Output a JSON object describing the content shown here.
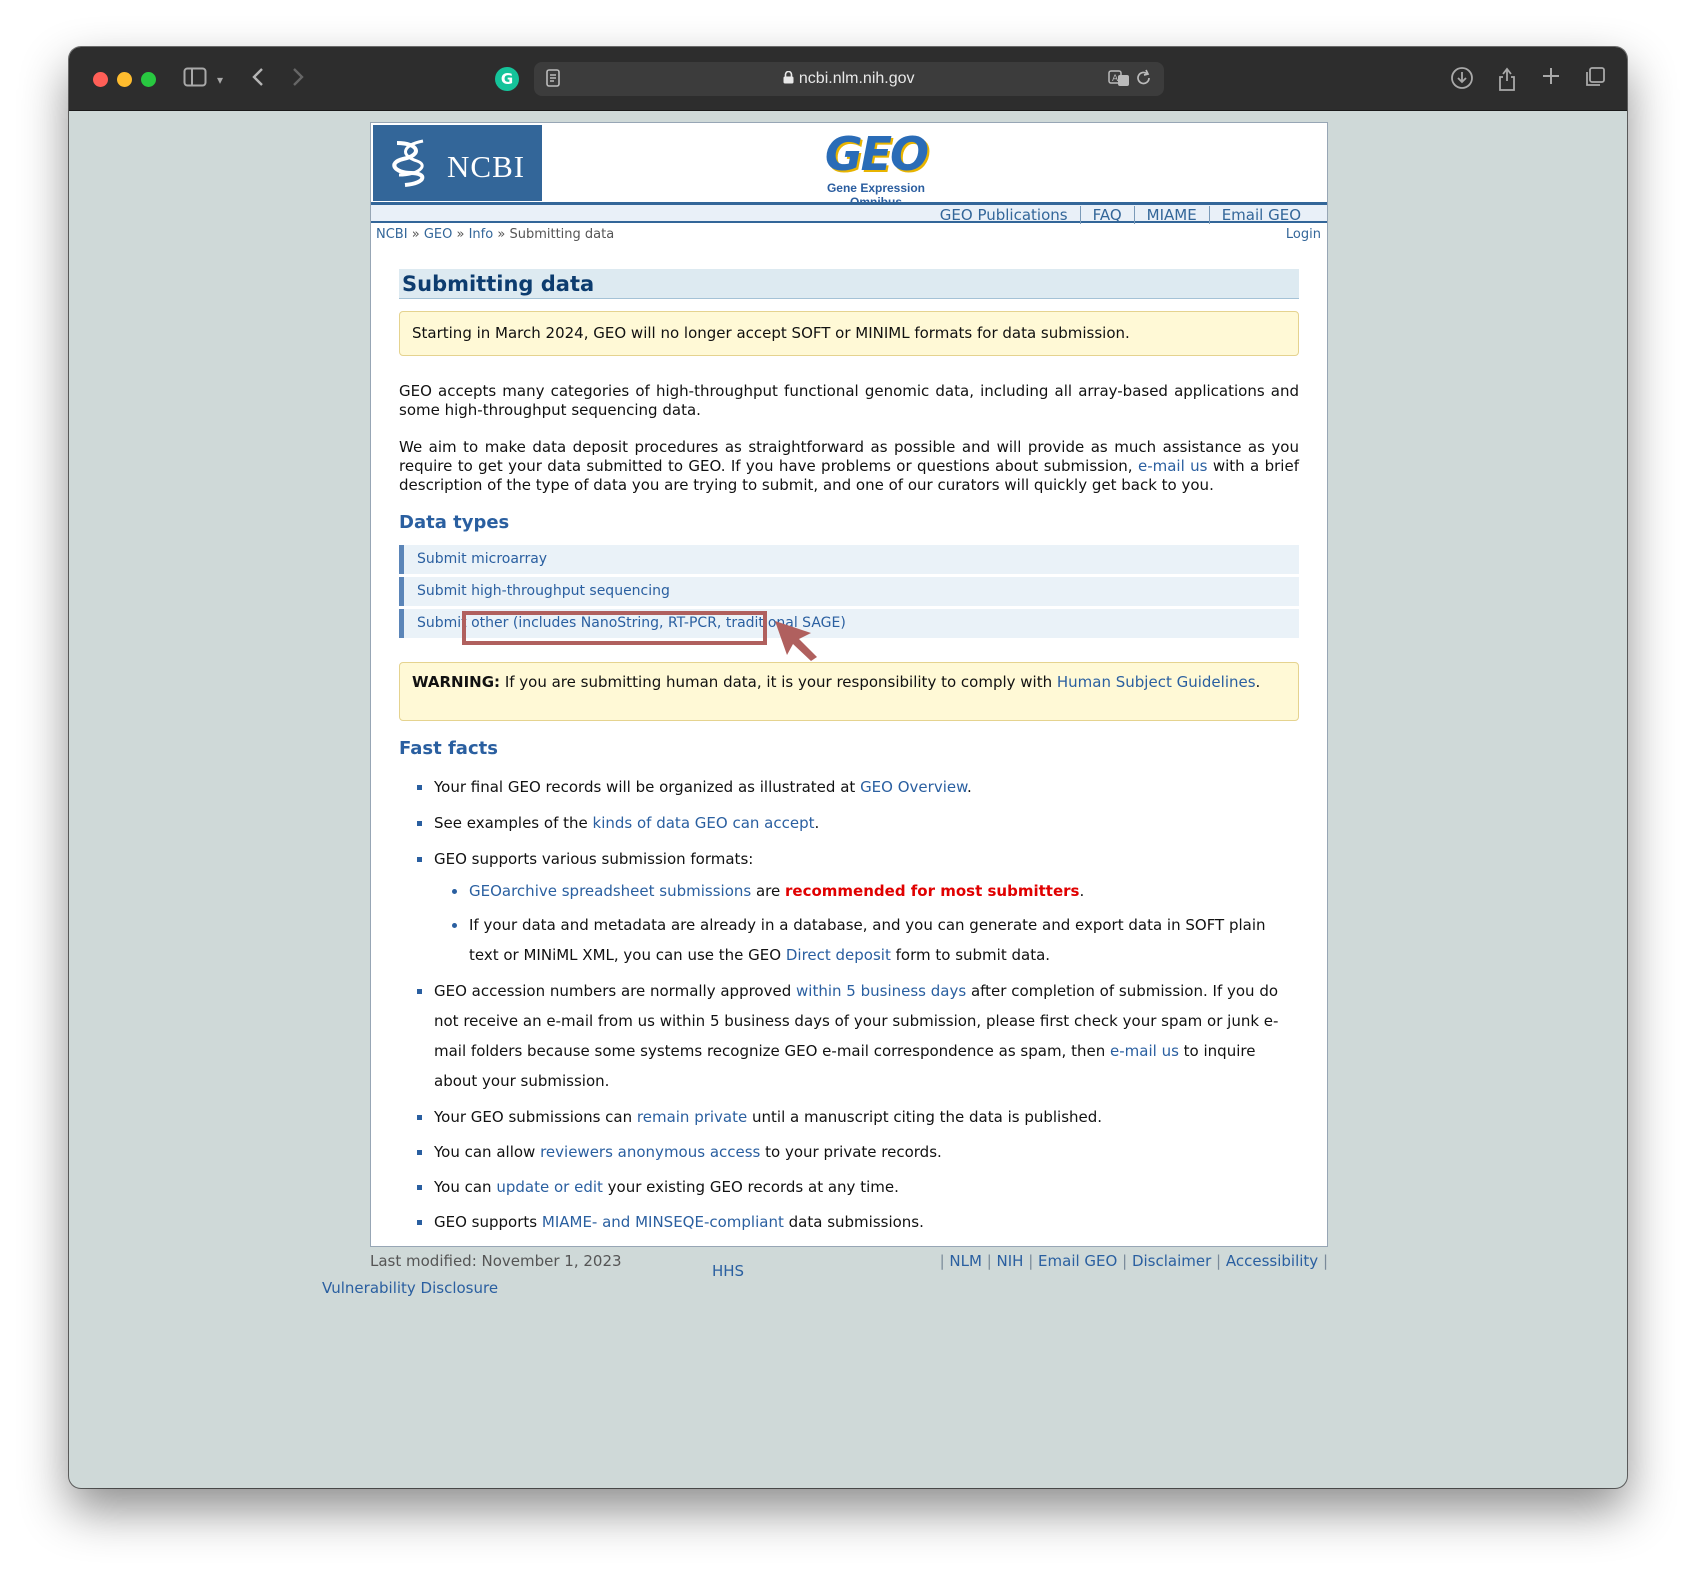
{
  "browser": {
    "url": "ncbi.nlm.nih.gov",
    "grammarly_letter": "G"
  },
  "header": {
    "ncbi_label": "NCBI",
    "geo_logo_text": "GEO",
    "geo_subtitle": "Gene Expression Omnibus",
    "nav": [
      "GEO Publications",
      "FAQ",
      "MIAME",
      "Email GEO"
    ],
    "breadcrumb": [
      "NCBI",
      "GEO",
      "Info",
      "Submitting data"
    ],
    "breadcrumb_sep": "»",
    "login": "Login"
  },
  "main": {
    "title": "Submitting data",
    "notice": "Starting in March 2024, GEO will no longer accept SOFT or MINIML formats for data submission.",
    "para1": "GEO accepts many categories of high-throughput functional genomic data, including all array-based applications and some high-throughput sequencing data.",
    "para2_a": "We aim to make data deposit procedures as straightforward as possible and will provide as much assistance as you require to get your data submitted to GEO. If you have problems or questions about submission,",
    "para2_link": "e-mail us",
    "para2_b": "with a brief description of the type of data you are trying to submit, and one of our curators will quickly get back to you.",
    "data_types_heading": "Data types",
    "data_types": [
      "Submit microarray",
      "Submit high-throughput sequencing",
      "Submit other (includes NanoString, RT-PCR, traditional SAGE)"
    ],
    "warning_label": "WARNING:",
    "warning_text": "If you are submitting human data, it is your responsibility to comply with",
    "warning_link": "Human Subject Guidelines",
    "warning_end": ".",
    "fast_facts_heading": "Fast facts",
    "facts": {
      "f1_a": "Your final GEO records will be organized as illustrated at",
      "f1_link": "GEO Overview",
      "f1_b": ".",
      "f2_a": "See examples of the",
      "f2_link": "kinds of data GEO can accept",
      "f2_b": ".",
      "f3": "GEO supports various submission formats:",
      "f3s1_link": "GEOarchive spreadsheet submissions",
      "f3s1_a": "are",
      "f3s1_red": "recommended for most submitters",
      "f3s1_b": ".",
      "f3s2_a": "If your data and metadata are already in a database, and you can generate and export data in SOFT plain text or MINiML XML, you can use the GEO",
      "f3s2_link": "Direct deposit",
      "f3s2_b": "form to submit data.",
      "f4_a": "GEO accession numbers are normally approved",
      "f4_link": "within 5 business days",
      "f4_b": "after completion of submission. If you do not receive an e-mail from us within 5 business days of your submission, please first check your spam or junk e-mail folders because some systems recognize GEO e-mail correspondence as spam, then",
      "f4_link2": "e-mail us",
      "f4_c": "to inquire about your submission.",
      "f5_a": "Your GEO submissions can",
      "f5_link": "remain private",
      "f5_b": "until a manuscript citing the data is published.",
      "f6_a": "You can allow",
      "f6_link": "reviewers anonymous access",
      "f6_b": "to your private records.",
      "f7_a": "You can",
      "f7_link": "update or edit",
      "f7_b": "your existing GEO records at any time.",
      "f8_a": "GEO supports",
      "f8_link": "MIAME- and MINSEQE-compliant",
      "f8_b": "data submissions."
    }
  },
  "footer": {
    "last_modified": "Last modified: November 1, 2023",
    "hhs": "HHS",
    "links": [
      "NLM",
      "NIH",
      "Email GEO",
      "Disclaimer",
      "Accessibility"
    ],
    "vuln": "Vulnerability Disclosure"
  },
  "annotation_color": "#b0605e"
}
